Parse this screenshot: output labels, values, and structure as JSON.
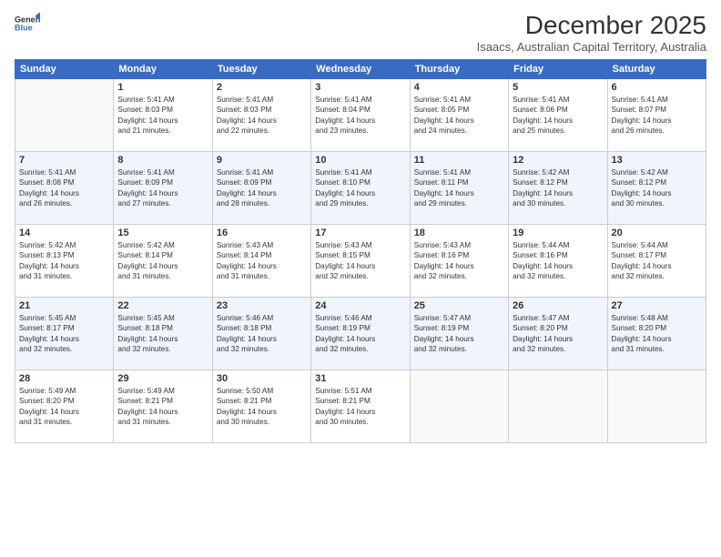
{
  "header": {
    "logo_line1": "General",
    "logo_line2": "Blue",
    "month": "December 2025",
    "location": "Isaacs, Australian Capital Territory, Australia"
  },
  "weekdays": [
    "Sunday",
    "Monday",
    "Tuesday",
    "Wednesday",
    "Thursday",
    "Friday",
    "Saturday"
  ],
  "weeks": [
    [
      {
        "day": "",
        "info": ""
      },
      {
        "day": "1",
        "info": "Sunrise: 5:41 AM\nSunset: 8:03 PM\nDaylight: 14 hours\nand 21 minutes."
      },
      {
        "day": "2",
        "info": "Sunrise: 5:41 AM\nSunset: 8:03 PM\nDaylight: 14 hours\nand 22 minutes."
      },
      {
        "day": "3",
        "info": "Sunrise: 5:41 AM\nSunset: 8:04 PM\nDaylight: 14 hours\nand 23 minutes."
      },
      {
        "day": "4",
        "info": "Sunrise: 5:41 AM\nSunset: 8:05 PM\nDaylight: 14 hours\nand 24 minutes."
      },
      {
        "day": "5",
        "info": "Sunrise: 5:41 AM\nSunset: 8:06 PM\nDaylight: 14 hours\nand 25 minutes."
      },
      {
        "day": "6",
        "info": "Sunrise: 5:41 AM\nSunset: 8:07 PM\nDaylight: 14 hours\nand 26 minutes."
      }
    ],
    [
      {
        "day": "7",
        "info": "Sunrise: 5:41 AM\nSunset: 8:08 PM\nDaylight: 14 hours\nand 26 minutes."
      },
      {
        "day": "8",
        "info": "Sunrise: 5:41 AM\nSunset: 8:09 PM\nDaylight: 14 hours\nand 27 minutes."
      },
      {
        "day": "9",
        "info": "Sunrise: 5:41 AM\nSunset: 8:09 PM\nDaylight: 14 hours\nand 28 minutes."
      },
      {
        "day": "10",
        "info": "Sunrise: 5:41 AM\nSunset: 8:10 PM\nDaylight: 14 hours\nand 29 minutes."
      },
      {
        "day": "11",
        "info": "Sunrise: 5:41 AM\nSunset: 8:11 PM\nDaylight: 14 hours\nand 29 minutes."
      },
      {
        "day": "12",
        "info": "Sunrise: 5:42 AM\nSunset: 8:12 PM\nDaylight: 14 hours\nand 30 minutes."
      },
      {
        "day": "13",
        "info": "Sunrise: 5:42 AM\nSunset: 8:12 PM\nDaylight: 14 hours\nand 30 minutes."
      }
    ],
    [
      {
        "day": "14",
        "info": "Sunrise: 5:42 AM\nSunset: 8:13 PM\nDaylight: 14 hours\nand 31 minutes."
      },
      {
        "day": "15",
        "info": "Sunrise: 5:42 AM\nSunset: 8:14 PM\nDaylight: 14 hours\nand 31 minutes."
      },
      {
        "day": "16",
        "info": "Sunrise: 5:43 AM\nSunset: 8:14 PM\nDaylight: 14 hours\nand 31 minutes."
      },
      {
        "day": "17",
        "info": "Sunrise: 5:43 AM\nSunset: 8:15 PM\nDaylight: 14 hours\nand 32 minutes."
      },
      {
        "day": "18",
        "info": "Sunrise: 5:43 AM\nSunset: 8:16 PM\nDaylight: 14 hours\nand 32 minutes."
      },
      {
        "day": "19",
        "info": "Sunrise: 5:44 AM\nSunset: 8:16 PM\nDaylight: 14 hours\nand 32 minutes."
      },
      {
        "day": "20",
        "info": "Sunrise: 5:44 AM\nSunset: 8:17 PM\nDaylight: 14 hours\nand 32 minutes."
      }
    ],
    [
      {
        "day": "21",
        "info": "Sunrise: 5:45 AM\nSunset: 8:17 PM\nDaylight: 14 hours\nand 32 minutes."
      },
      {
        "day": "22",
        "info": "Sunrise: 5:45 AM\nSunset: 8:18 PM\nDaylight: 14 hours\nand 32 minutes."
      },
      {
        "day": "23",
        "info": "Sunrise: 5:46 AM\nSunset: 8:18 PM\nDaylight: 14 hours\nand 32 minutes."
      },
      {
        "day": "24",
        "info": "Sunrise: 5:46 AM\nSunset: 8:19 PM\nDaylight: 14 hours\nand 32 minutes."
      },
      {
        "day": "25",
        "info": "Sunrise: 5:47 AM\nSunset: 8:19 PM\nDaylight: 14 hours\nand 32 minutes."
      },
      {
        "day": "26",
        "info": "Sunrise: 5:47 AM\nSunset: 8:20 PM\nDaylight: 14 hours\nand 32 minutes."
      },
      {
        "day": "27",
        "info": "Sunrise: 5:48 AM\nSunset: 8:20 PM\nDaylight: 14 hours\nand 31 minutes."
      }
    ],
    [
      {
        "day": "28",
        "info": "Sunrise: 5:49 AM\nSunset: 8:20 PM\nDaylight: 14 hours\nand 31 minutes."
      },
      {
        "day": "29",
        "info": "Sunrise: 5:49 AM\nSunset: 8:21 PM\nDaylight: 14 hours\nand 31 minutes."
      },
      {
        "day": "30",
        "info": "Sunrise: 5:50 AM\nSunset: 8:21 PM\nDaylight: 14 hours\nand 30 minutes."
      },
      {
        "day": "31",
        "info": "Sunrise: 5:51 AM\nSunset: 8:21 PM\nDaylight: 14 hours\nand 30 minutes."
      },
      {
        "day": "",
        "info": ""
      },
      {
        "day": "",
        "info": ""
      },
      {
        "day": "",
        "info": ""
      }
    ]
  ]
}
